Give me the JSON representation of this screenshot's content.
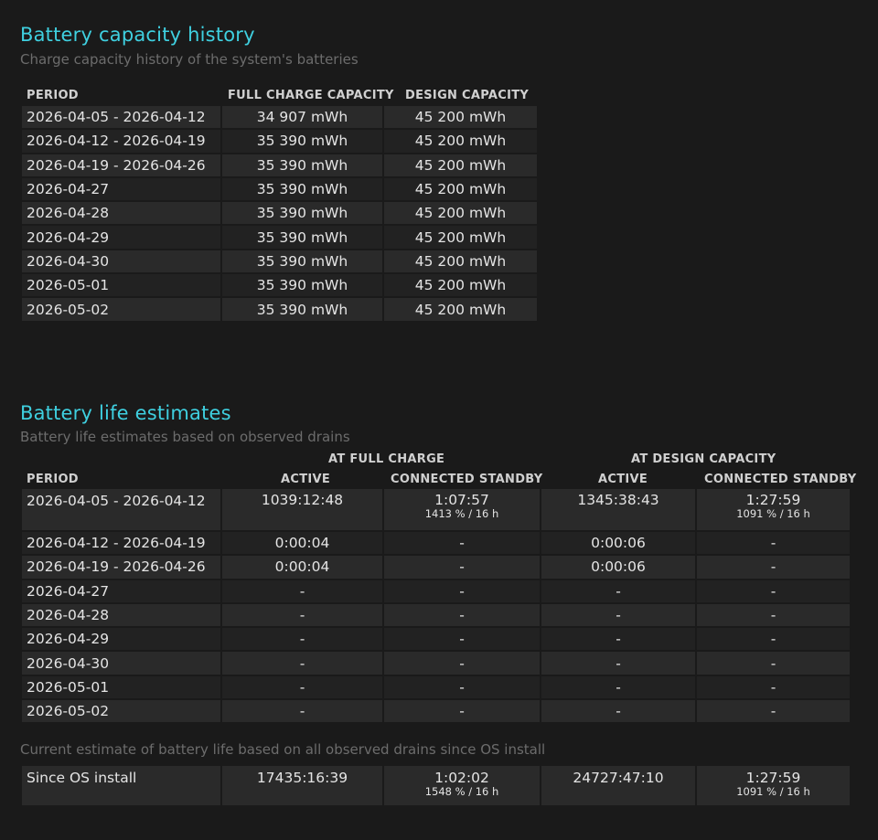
{
  "capacity_section": {
    "title": "Battery capacity history",
    "subtitle": "Charge capacity history of the system's batteries",
    "headers": {
      "period": "PERIOD",
      "full_charge": "FULL CHARGE CAPACITY",
      "design": "DESIGN CAPACITY"
    },
    "rows": [
      {
        "period": "2026-04-05 - 2026-04-12",
        "full": "34 907 mWh",
        "design": "45 200 mWh"
      },
      {
        "period": "2026-04-12 - 2026-04-19",
        "full": "35 390 mWh",
        "design": "45 200 mWh"
      },
      {
        "period": "2026-04-19 - 2026-04-26",
        "full": "35 390 mWh",
        "design": "45 200 mWh"
      },
      {
        "period": "2026-04-27",
        "full": "35 390 mWh",
        "design": "45 200 mWh"
      },
      {
        "period": "2026-04-28",
        "full": "35 390 mWh",
        "design": "45 200 mWh"
      },
      {
        "period": "2026-04-29",
        "full": "35 390 mWh",
        "design": "45 200 mWh"
      },
      {
        "period": "2026-04-30",
        "full": "35 390 mWh",
        "design": "45 200 mWh"
      },
      {
        "period": "2026-05-01",
        "full": "35 390 mWh",
        "design": "45 200 mWh"
      },
      {
        "period": "2026-05-02",
        "full": "35 390 mWh",
        "design": "45 200 mWh"
      }
    ]
  },
  "life_section": {
    "title": "Battery life estimates",
    "subtitle": "Battery life estimates based on observed drains",
    "group_headers": {
      "full_charge": "AT FULL CHARGE",
      "design_capacity": "AT DESIGN CAPACITY"
    },
    "headers": {
      "period": "PERIOD",
      "fc_active": "ACTIVE",
      "fc_standby": "CONNECTED STANDBY",
      "dc_active": "ACTIVE",
      "dc_standby": "CONNECTED STANDBY"
    },
    "rows": [
      {
        "period": "2026-04-05 - 2026-04-12",
        "fc_active": "1039:12:48",
        "fc_standby": "1:07:57",
        "fc_standby_note": "1413 % / 16 h",
        "dc_active": "1345:38:43",
        "dc_standby": "1:27:59",
        "dc_standby_note": "1091 % / 16 h"
      },
      {
        "period": "2026-04-12 - 2026-04-19",
        "fc_active": "0:00:04",
        "fc_standby": "-",
        "dc_active": "0:00:06",
        "dc_standby": "-"
      },
      {
        "period": "2026-04-19 - 2026-04-26",
        "fc_active": "0:00:04",
        "fc_standby": "-",
        "dc_active": "0:00:06",
        "dc_standby": "-"
      },
      {
        "period": "2026-04-27",
        "fc_active": "-",
        "fc_standby": "-",
        "dc_active": "-",
        "dc_standby": "-"
      },
      {
        "period": "2026-04-28",
        "fc_active": "-",
        "fc_standby": "-",
        "dc_active": "-",
        "dc_standby": "-"
      },
      {
        "period": "2026-04-29",
        "fc_active": "-",
        "fc_standby": "-",
        "dc_active": "-",
        "dc_standby": "-"
      },
      {
        "period": "2026-04-30",
        "fc_active": "-",
        "fc_standby": "-",
        "dc_active": "-",
        "dc_standby": "-"
      },
      {
        "period": "2026-05-01",
        "fc_active": "-",
        "fc_standby": "-",
        "dc_active": "-",
        "dc_standby": "-"
      },
      {
        "period": "2026-05-02",
        "fc_active": "-",
        "fc_standby": "-",
        "dc_active": "-",
        "dc_standby": "-"
      }
    ]
  },
  "install_section": {
    "subtitle": "Current estimate of battery life based on all observed drains since OS install",
    "row": {
      "period": "Since OS install",
      "fc_active": "17435:16:39",
      "fc_standby": "1:02:02",
      "fc_standby_note": "1548 % / 16 h",
      "dc_active": "24727:47:10",
      "dc_standby": "1:27:59",
      "dc_standby_note": "1091 % / 16 h"
    }
  },
  "colors": {
    "background": "#1a1a1a",
    "heading_accent": "#3fd0e0",
    "subtitle": "#6c6c6c",
    "row_odd": "#2a2a2a",
    "row_even": "#222222"
  }
}
